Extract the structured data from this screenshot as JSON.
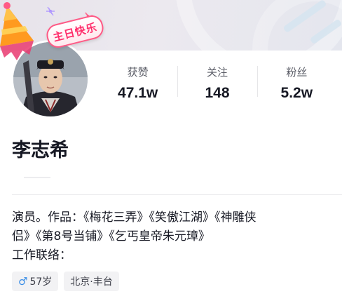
{
  "profile": {
    "name": "李志希",
    "birthday_badge": "主日快乐"
  },
  "stats": [
    {
      "label": "获赞",
      "value": "47.1w"
    },
    {
      "label": "关注",
      "value": "148"
    },
    {
      "label": "粉丝",
      "value": "5.2w"
    }
  ],
  "bio": {
    "line1": "演员。作品：《梅花三弄》《笑傲江湖》《神雕侠",
    "line2": "侣》《第8号当铺》《乞丐皇帝朱元璋》",
    "line3": "工作联络："
  },
  "tags": {
    "gender_icon": "male-icon",
    "gender_symbol": "♂",
    "age": "57岁",
    "location": "北京·丰台"
  },
  "colors": {
    "accent_pink": "#ff2d6a",
    "male_blue": "#3a8ee6",
    "text_primary": "#161823",
    "text_secondary": "#5a5c66"
  }
}
